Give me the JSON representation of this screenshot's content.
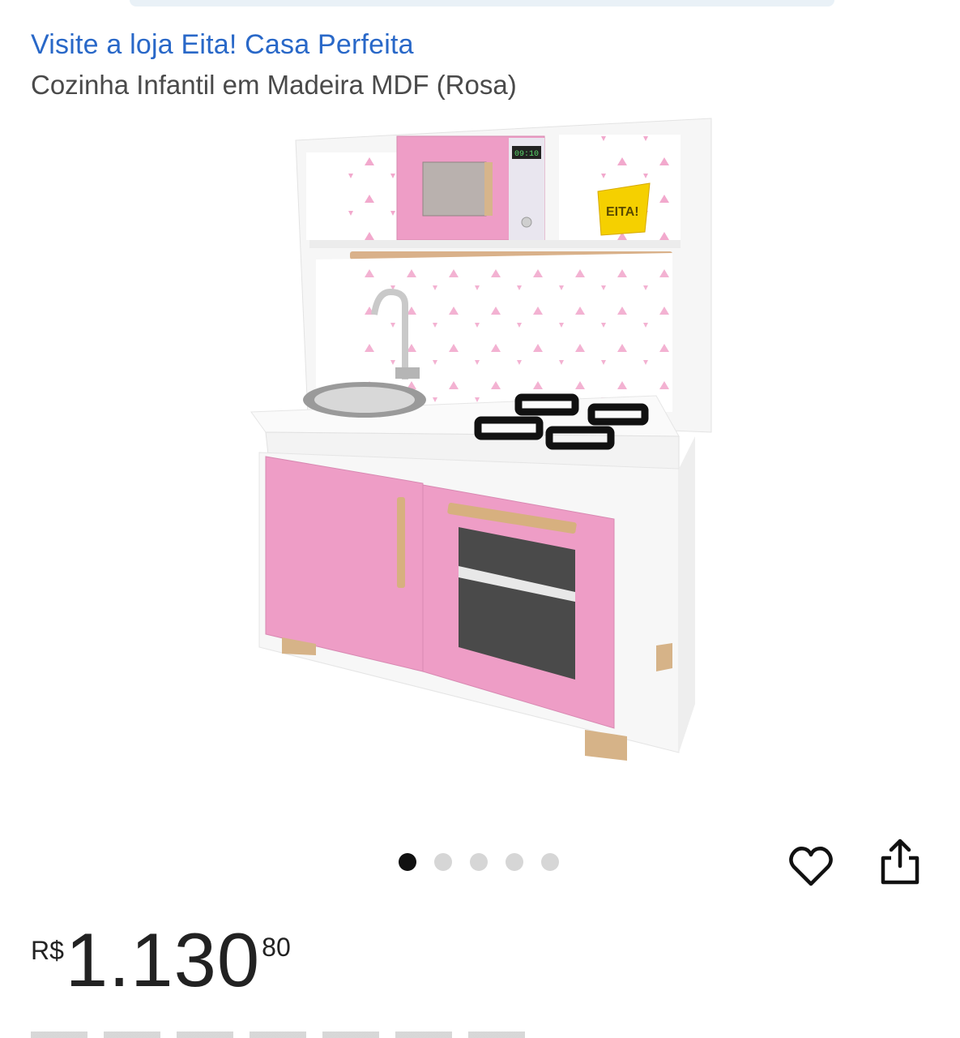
{
  "store": {
    "link_text": "Visite a loja Eita! Casa Perfeita"
  },
  "product": {
    "title": "Cozinha Infantil em Madeira MDF (Rosa)",
    "image_logo_text": "EITA!",
    "microwave_clock": "09:10"
  },
  "carousel": {
    "total": 5,
    "active_index": 0
  },
  "price": {
    "currency": "R$",
    "integer": "1.130",
    "cents": "80"
  },
  "icons": {
    "favorite": "heart-icon",
    "share": "share-icon"
  },
  "colors": {
    "link": "#2968c8",
    "pink": "#ee9dc6",
    "text": "#222222"
  }
}
